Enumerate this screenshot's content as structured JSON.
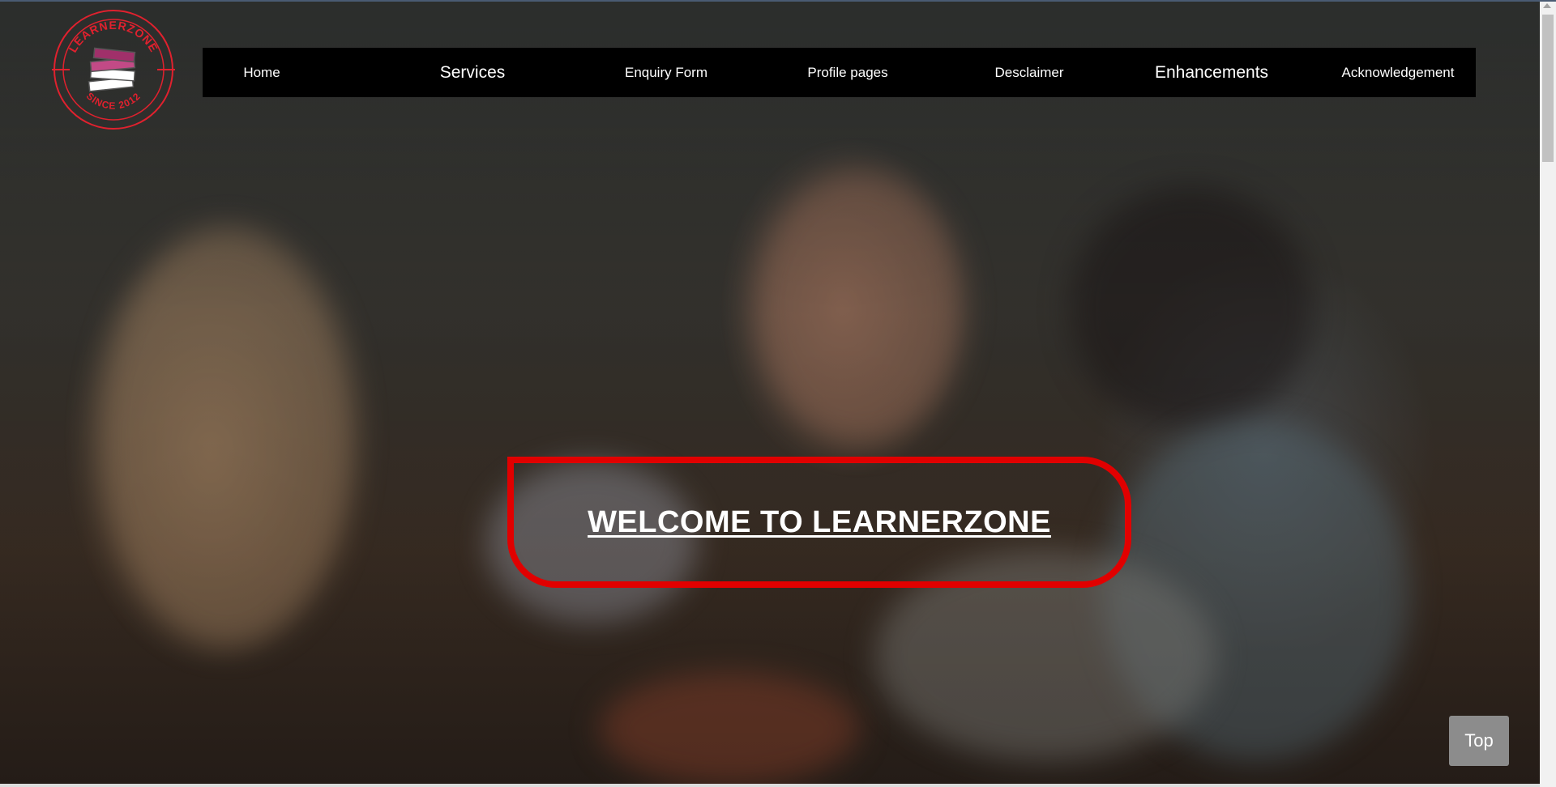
{
  "logo": {
    "top_text": "LEARNERZONE",
    "bottom_text": "SINCE 2012",
    "color": "#e0212e",
    "books_color": "#a0306a"
  },
  "nav": {
    "items": [
      {
        "label": "Home"
      },
      {
        "label": "Services"
      },
      {
        "label": "Enquiry Form"
      },
      {
        "label": "Profile pages"
      },
      {
        "label": "Desclaimer"
      },
      {
        "label": "Enhancements"
      },
      {
        "label": "Acknowledgement"
      }
    ]
  },
  "hero": {
    "welcome": "WELCOME TO LEARNERZONE",
    "border_color": "#e10000"
  },
  "top_button": {
    "label": "Top"
  }
}
